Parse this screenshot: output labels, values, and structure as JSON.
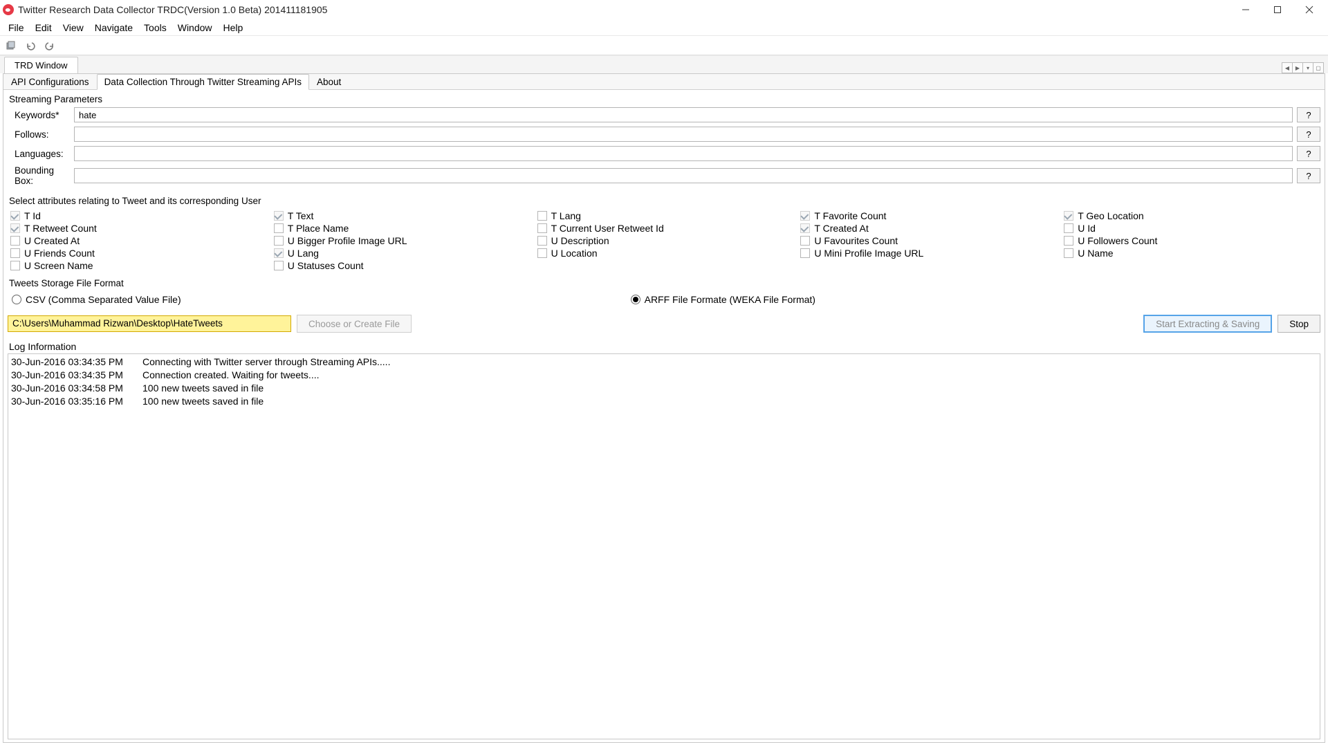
{
  "window": {
    "title": "Twitter Research Data Collector TRDC(Version 1.0 Beta) 201411181905"
  },
  "menu": [
    "File",
    "Edit",
    "View",
    "Navigate",
    "Tools",
    "Window",
    "Help"
  ],
  "window_tab": "TRD Window",
  "inner_tabs": {
    "api": "API Configurations",
    "collect": "Data Collection Through Twitter Streaming APIs",
    "about": "About"
  },
  "streaming": {
    "title": "Streaming Parameters",
    "keywords_label": "Keywords*",
    "keywords_value": "hate",
    "follows_label": "Follows:",
    "follows_value": "",
    "languages_label": "Languages:",
    "languages_value": "",
    "bbox_label": "Bounding Box:",
    "bbox_value": "",
    "help": "?"
  },
  "attrs": {
    "title": "Select attributes relating to Tweet and its corresponding User",
    "items": [
      {
        "label": "T Id",
        "checked": true,
        "disabled": true
      },
      {
        "label": "T Text",
        "checked": true,
        "disabled": true
      },
      {
        "label": "T Lang",
        "checked": false,
        "disabled": false
      },
      {
        "label": "T Favorite Count",
        "checked": true,
        "disabled": true
      },
      {
        "label": "T Geo Location",
        "checked": true,
        "disabled": true
      },
      {
        "label": "T Retweet Count",
        "checked": true,
        "disabled": true
      },
      {
        "label": "T Place Name",
        "checked": false,
        "disabled": false
      },
      {
        "label": "T Current User Retweet Id",
        "checked": false,
        "disabled": false
      },
      {
        "label": "T Created At",
        "checked": true,
        "disabled": true
      },
      {
        "label": "U Id",
        "checked": false,
        "disabled": false
      },
      {
        "label": "U Created At",
        "checked": false,
        "disabled": false
      },
      {
        "label": "U Bigger Profile Image URL",
        "checked": false,
        "disabled": false
      },
      {
        "label": "U Description",
        "checked": false,
        "disabled": false
      },
      {
        "label": "U Favourites Count",
        "checked": false,
        "disabled": false
      },
      {
        "label": "U Followers Count",
        "checked": false,
        "disabled": false
      },
      {
        "label": "U Friends Count",
        "checked": false,
        "disabled": false
      },
      {
        "label": "U Lang",
        "checked": true,
        "disabled": true
      },
      {
        "label": "U Location",
        "checked": false,
        "disabled": false
      },
      {
        "label": "U Mini Profile Image URL",
        "checked": false,
        "disabled": false
      },
      {
        "label": "U Name",
        "checked": false,
        "disabled": false
      },
      {
        "label": "U Screen Name",
        "checked": false,
        "disabled": false
      },
      {
        "label": "U Statuses Count",
        "checked": false,
        "disabled": false
      }
    ]
  },
  "storage": {
    "title": "Tweets Storage File Format",
    "csv": "CSV (Comma Separated Value File)",
    "arff": "ARFF File Formate (WEKA File Format)",
    "selected": "arff"
  },
  "file": {
    "path": "C:\\Users\\Muhammad Rizwan\\Desktop\\HateTweets",
    "choose": "Choose or Create File",
    "start": "Start Extracting & Saving",
    "stop": "Stop"
  },
  "log": {
    "title": "Log Information",
    "entries": [
      {
        "ts": "30-Jun-2016 03:34:35 PM",
        "msg": "Connecting with Twitter server through Streaming APIs....."
      },
      {
        "ts": "30-Jun-2016 03:34:35 PM",
        "msg": "Connection created. Waiting for tweets...."
      },
      {
        "ts": "30-Jun-2016 03:34:58 PM",
        "msg": "100 new tweets saved in file"
      },
      {
        "ts": "30-Jun-2016 03:35:16 PM",
        "msg": "100 new tweets saved in file"
      }
    ]
  }
}
